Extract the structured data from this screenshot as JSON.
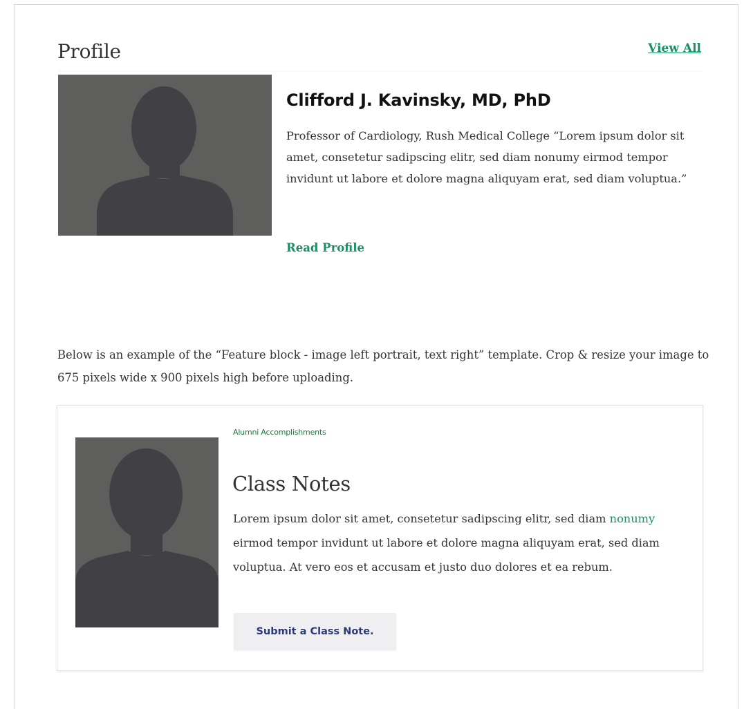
{
  "profile": {
    "heading": "Profile",
    "view_all": "View All",
    "name": "Clifford J. Kavinsky, MD, PhD",
    "bio": "Professor of Cardiology, Rush Medical College “Lorem ipsum dolor sit amet, consetetur sadipscing elitr, sed diam nonumy eirmod tempor invidunt ut labore et dolore magna aliquyam erat, sed diam voluptua.”",
    "read_profile": "Read Profile"
  },
  "instructions": "Below is an example of the “Feature block - image left portrait, text right” template. Crop & resize your image to 675 pixels wide x 900 pixels high before uploading.",
  "feature": {
    "eyebrow": "Alumni Accomplishments",
    "title": "Class Notes",
    "body_before": "Lorem ipsum dolor sit amet, consetetur sadipscing elitr, sed diam ",
    "body_link": "nonumy",
    "body_after": " eirmod tempor invidunt ut labore et dolore magna aliquyam erat, sed diam voluptua. At vero eos et accusam et justo duo dolores et ea rebum.",
    "button_label": "Submit a Class Note."
  },
  "colors": {
    "accent_green": "#1a9061",
    "eyebrow_green": "#1a7a3a",
    "button_text": "#2b3a78",
    "button_bg": "#efeff1",
    "portrait_bg": "#5e5e5c",
    "silhouette": "#414145"
  },
  "icons": {
    "portrait_placeholder": "person-silhouette-icon"
  }
}
